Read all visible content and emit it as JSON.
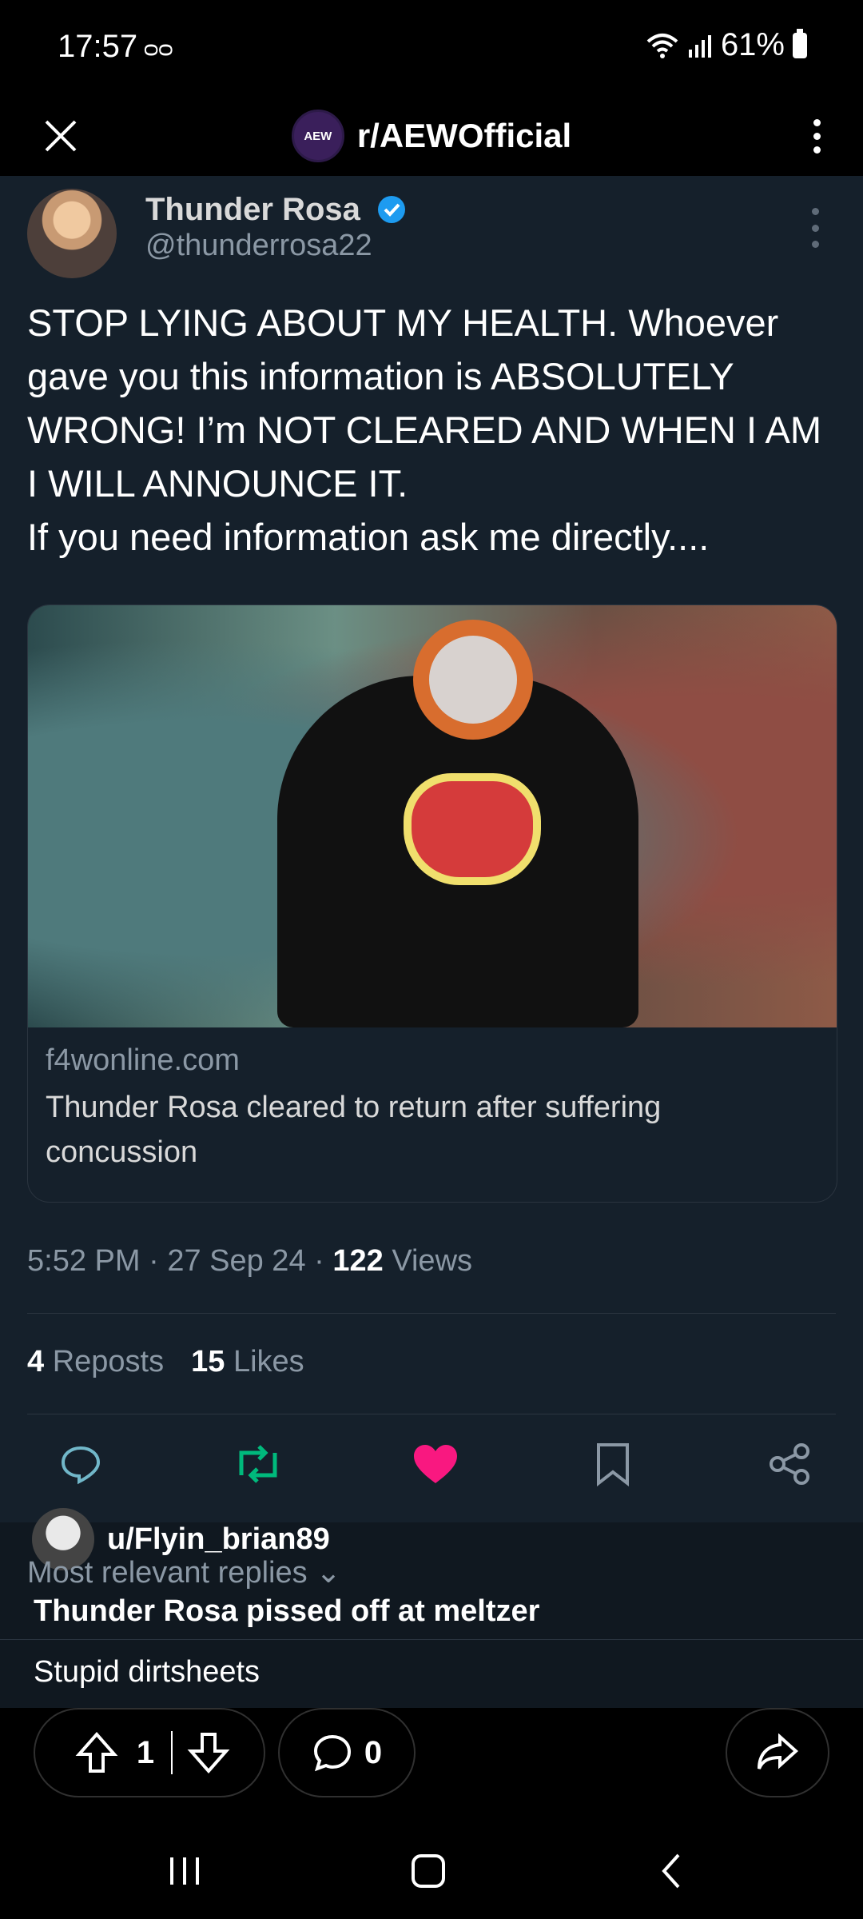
{
  "status_bar": {
    "time": "17:57",
    "voicemail_icon": "voicemail-icon",
    "battery": "61%"
  },
  "header": {
    "subreddit": "r/AEWOfficial",
    "logo_text": "AEW"
  },
  "tweet": {
    "author_name": "Thunder Rosa",
    "author_handle": "@thunderrosa22",
    "text": "STOP LYING ABOUT MY HEALTH. Whoever gave you this information is ABSOLUTELY WRONG! I’m NOT CLEARED AND WHEN I AM I WILL ANNOUNCE IT.\nIf you need information ask me directly....",
    "card": {
      "domain": "f4wonline.com",
      "title": "Thunder Rosa cleared to return after suffering concussion"
    },
    "meta": {
      "time": "5:52 PM",
      "date": "27 Sep 24",
      "views_count": "122",
      "views_label": "Views"
    },
    "stats": {
      "reposts_count": "4",
      "reposts_label": "Reposts",
      "likes_count": "15",
      "likes_label": "Likes"
    }
  },
  "reddit_post": {
    "username": "u/Flyin_brian89",
    "replies_filter": "Most relevant replies",
    "title": "Thunder Rosa pissed off at meltzer",
    "body": "Stupid dirtsheets"
  },
  "bottom_bar": {
    "upvotes": "1",
    "comments": "0"
  },
  "colors": {
    "tweet_bg": "#15202b",
    "like": "#f91880",
    "repost": "#00ba7c",
    "verified": "#1d9bf0"
  }
}
